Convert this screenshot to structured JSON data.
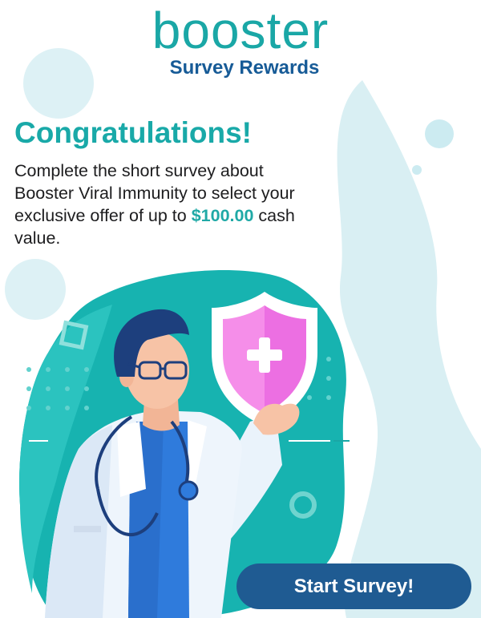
{
  "brand": {
    "name": "booster",
    "tagline": "Survey Rewards",
    "primary_color": "#1aa7a6",
    "secondary_color": "#175b97"
  },
  "offer": {
    "headline": "Congratulations!",
    "body_before": "Complete the short survey about Booster Viral Immunity to select your exclusive offer of up to ",
    "amount": "$100.00",
    "body_after": " cash value."
  },
  "illustration": {
    "subject": "doctor holding a shield with a plus sign",
    "icons": [
      "shield-plus-icon",
      "stethoscope-icon",
      "glasses-icon"
    ]
  },
  "cta": {
    "label": "Start Survey!",
    "color": "#1f5b92"
  }
}
